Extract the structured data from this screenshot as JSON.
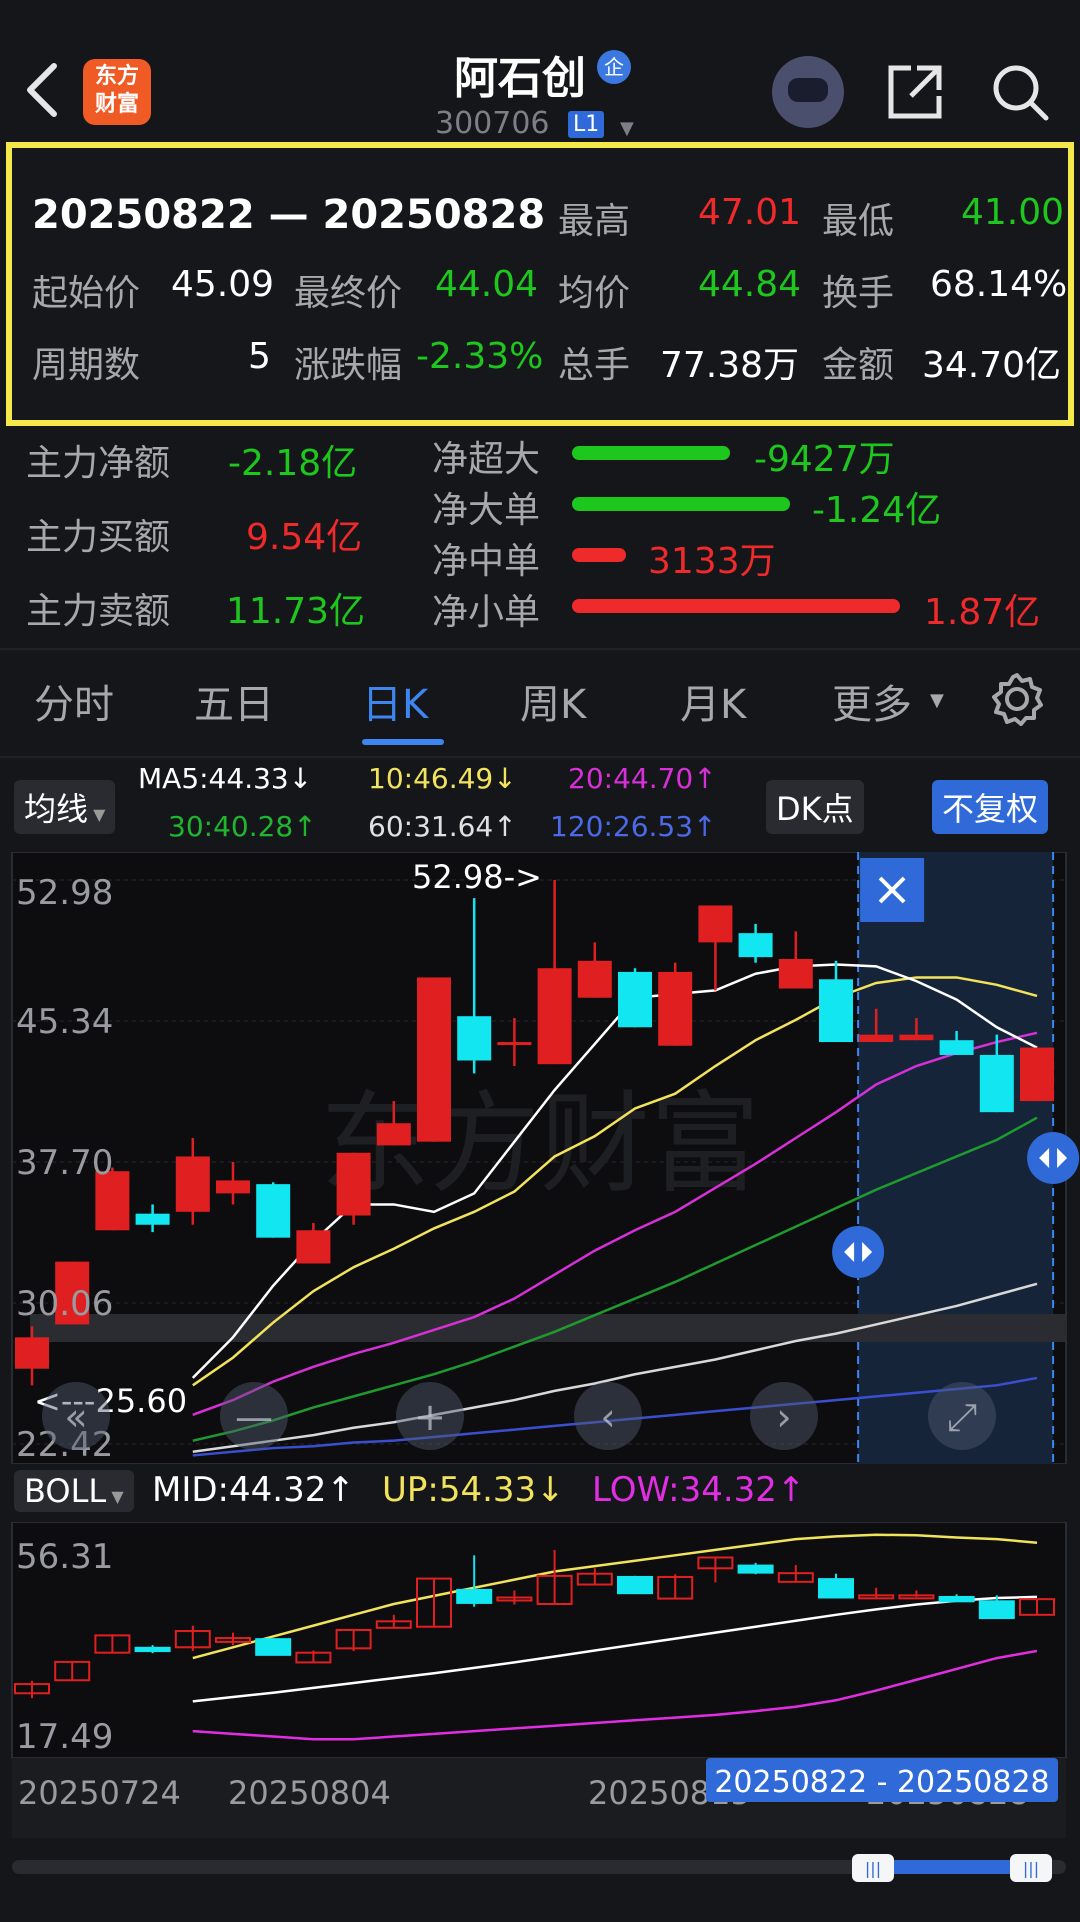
{
  "header": {
    "logo_text": "东方\n财富",
    "title": "阿石创",
    "title_badge": "企",
    "code": "300706",
    "level": "L1"
  },
  "summary": {
    "date_range": "20250822 — 20250828",
    "high_label": "最高",
    "high": "47.01",
    "low_label": "最低",
    "low": "41.00",
    "open_label": "起始价",
    "open": "45.09",
    "close_label": "最终价",
    "close": "44.04",
    "avg_label": "均价",
    "avg": "44.84",
    "turnover_label": "换手",
    "turnover": "68.14%",
    "periods_label": "周期数",
    "periods": "5",
    "change_label": "涨跌幅",
    "change": "-2.33%",
    "volume_label": "总手",
    "volume": "77.38万",
    "amount_label": "金额",
    "amount": "34.70亿"
  },
  "fund_flow": {
    "net_main_label": "主力净额",
    "net_main": "-2.18亿",
    "main_buy_label": "主力买额",
    "main_buy": "9.54亿",
    "main_sell_label": "主力卖额",
    "main_sell": "11.73亿",
    "bars": [
      {
        "label": "净超大",
        "value": "-9427万",
        "color": "#1ec71e",
        "fraction": 0.22
      },
      {
        "label": "净大单",
        "value": "-1.24亿",
        "color": "#1ec71e",
        "fraction": 0.29
      },
      {
        "label": "净中单",
        "value": "3133万",
        "color": "#ee2a2a",
        "fraction": 0.07
      },
      {
        "label": "净小单",
        "value": "1.87亿",
        "color": "#ee2a2a",
        "fraction": 0.43
      }
    ]
  },
  "tabs": [
    "分时",
    "五日",
    "日K",
    "周K",
    "月K",
    "更多"
  ],
  "active_tab": "日K",
  "chart_controls": {
    "ma_chip": "均线",
    "ma5": "MA5:44.33↓",
    "ma10": "10:46.49↓",
    "ma20": "20:44.70↑",
    "ma30": "30:40.28↑",
    "ma60": "60:31.64↑",
    "ma120": "120:26.53↑",
    "dk": "DK点",
    "adjust": "不复权",
    "boll_chip": "BOLL",
    "boll_mid": "MID:44.32↑",
    "boll_up": "UP:54.33↓",
    "boll_low": "LOW:34.32↑"
  },
  "watermark": "东方财富",
  "colors": {
    "up": "#e02020",
    "down": "#12e6f0",
    "ma5": "#ffffff",
    "ma10": "#f2e35c",
    "ma20": "#d630d6",
    "ma30": "#1f9a2e",
    "ma60": "#d8d8d8",
    "ma120": "#3a4fd0"
  },
  "chart_data": {
    "type": "candlestick",
    "y_axis_labels": [
      "52.98",
      "45.34",
      "37.70",
      "30.06",
      "22.42"
    ],
    "ylim": [
      22.42,
      52.98
    ],
    "max_marker": "52.98->",
    "min_marker": "<---25.60",
    "x_labels": [
      "20250724",
      "20250804",
      "20250815",
      "20250828"
    ],
    "selection_label": "20250822 - 20250828",
    "candles": [
      {
        "o": 26.5,
        "c": 28.2,
        "h": 28.8,
        "l": 25.6
      },
      {
        "o": 28.9,
        "c": 32.3,
        "h": 32.3,
        "l": 28.9
      },
      {
        "o": 34.0,
        "c": 37.2,
        "h": 37.4,
        "l": 34.0
      },
      {
        "o": 34.9,
        "c": 34.3,
        "h": 35.4,
        "l": 33.9
      },
      {
        "o": 35.0,
        "c": 38.0,
        "h": 39.0,
        "l": 34.3
      },
      {
        "o": 36.0,
        "c": 36.7,
        "h": 37.7,
        "l": 35.4
      },
      {
        "o": 36.5,
        "c": 33.6,
        "h": 36.6,
        "l": 33.6
      },
      {
        "o": 32.2,
        "c": 34.0,
        "h": 34.4,
        "l": 32.2
      },
      {
        "o": 34.8,
        "c": 38.2,
        "h": 38.2,
        "l": 34.3
      },
      {
        "o": 38.6,
        "c": 39.8,
        "h": 41.0,
        "l": 38.6
      },
      {
        "o": 38.8,
        "c": 47.7,
        "h": 47.7,
        "l": 38.8
      },
      {
        "o": 45.6,
        "c": 43.2,
        "h": 52.0,
        "l": 42.5
      },
      {
        "o": 44.2,
        "c": 44.2,
        "h": 45.5,
        "l": 42.9
      },
      {
        "o": 43.0,
        "c": 48.2,
        "h": 52.98,
        "l": 43.0
      },
      {
        "o": 46.6,
        "c": 48.6,
        "h": 49.6,
        "l": 46.6
      },
      {
        "o": 48.0,
        "c": 45.0,
        "h": 48.2,
        "l": 45.0
      },
      {
        "o": 44.0,
        "c": 48.0,
        "h": 48.5,
        "l": 44.0
      },
      {
        "o": 49.6,
        "c": 51.6,
        "h": 51.6,
        "l": 47.0
      },
      {
        "o": 50.1,
        "c": 48.8,
        "h": 50.6,
        "l": 48.5
      },
      {
        "o": 47.1,
        "c": 48.7,
        "h": 50.2,
        "l": 47.1
      },
      {
        "o": 47.6,
        "c": 44.2,
        "h": 48.6,
        "l": 44.2
      },
      {
        "o": 44.2,
        "c": 44.6,
        "h": 46.0,
        "l": 44.2
      },
      {
        "o": 44.3,
        "c": 44.6,
        "h": 45.5,
        "l": 44.3
      },
      {
        "o": 44.3,
        "c": 43.5,
        "h": 44.8,
        "l": 43.5
      },
      {
        "o": 43.5,
        "c": 40.4,
        "h": 44.6,
        "l": 40.4
      },
      {
        "o": 41.0,
        "c": 43.9,
        "h": 43.9,
        "l": 41.0
      }
    ],
    "ma5": [
      26.0,
      28.2,
      31.0,
      33.4,
      35.4,
      35.4,
      35.0,
      36.0,
      38.8,
      41.6,
      44.1,
      46.6,
      46.8,
      47.0,
      47.9,
      48.3,
      48.4,
      48.3,
      47.5,
      46.5,
      45.0,
      43.9
    ],
    "ma10": [
      25.6,
      27.1,
      29.0,
      30.7,
      32.0,
      33.0,
      34.1,
      35.0,
      36.1,
      38.0,
      39.1,
      40.6,
      41.4,
      42.9,
      44.3,
      45.4,
      46.6,
      47.4,
      47.7,
      47.7,
      47.3,
      46.7
    ],
    "ma20": [
      24.0,
      24.8,
      25.8,
      26.6,
      27.3,
      27.9,
      28.6,
      29.3,
      30.3,
      31.6,
      32.9,
      34.0,
      35.0,
      36.3,
      37.6,
      39.0,
      40.4,
      41.9,
      42.9,
      43.6,
      44.2,
      44.7
    ],
    "ma30": [
      22.6,
      23.1,
      23.7,
      24.4,
      25.0,
      25.6,
      26.2,
      26.9,
      27.7,
      28.5,
      29.4,
      30.3,
      31.2,
      32.2,
      33.2,
      34.2,
      35.2,
      36.2,
      37.1,
      38.0,
      38.9,
      40.1
    ],
    "ma60": [
      22.0,
      22.3,
      22.6,
      22.9,
      23.3,
      23.6,
      24.0,
      24.4,
      24.8,
      25.3,
      25.7,
      26.2,
      26.6,
      27.0,
      27.5,
      28.0,
      28.4,
      28.9,
      29.4,
      29.9,
      30.5,
      31.1
    ],
    "ma120": [
      21.8,
      22.0,
      22.2,
      22.3,
      22.5,
      22.6,
      22.8,
      23.0,
      23.2,
      23.4,
      23.6,
      23.8,
      24.0,
      24.2,
      24.4,
      24.6,
      24.8,
      25.0,
      25.2,
      25.4,
      25.6,
      26.0
    ],
    "boll": {
      "y_axis_labels": [
        "56.31",
        "17.49"
      ],
      "ylim": [
        17.49,
        56.31
      ],
      "up": [
        33,
        35,
        37,
        39,
        41,
        43,
        44.5,
        46,
        47.5,
        49,
        50,
        51,
        52,
        53,
        54,
        55,
        55.5,
        55.8,
        55.7,
        55.3,
        55.0,
        54.33
      ],
      "mid": [
        25,
        25.8,
        26.6,
        27.5,
        28.4,
        29.3,
        30.2,
        31.2,
        32.2,
        33.3,
        34.4,
        35.5,
        36.6,
        37.7,
        38.8,
        39.9,
        41.0,
        42.0,
        42.9,
        43.6,
        44.1,
        44.32
      ],
      "low": [
        19.5,
        19,
        18.5,
        18,
        18,
        18.5,
        19,
        19.5,
        20,
        20.5,
        21,
        21.5,
        22,
        22.5,
        23.2,
        24,
        25.2,
        27,
        29,
        31,
        33,
        34.32
      ]
    }
  }
}
